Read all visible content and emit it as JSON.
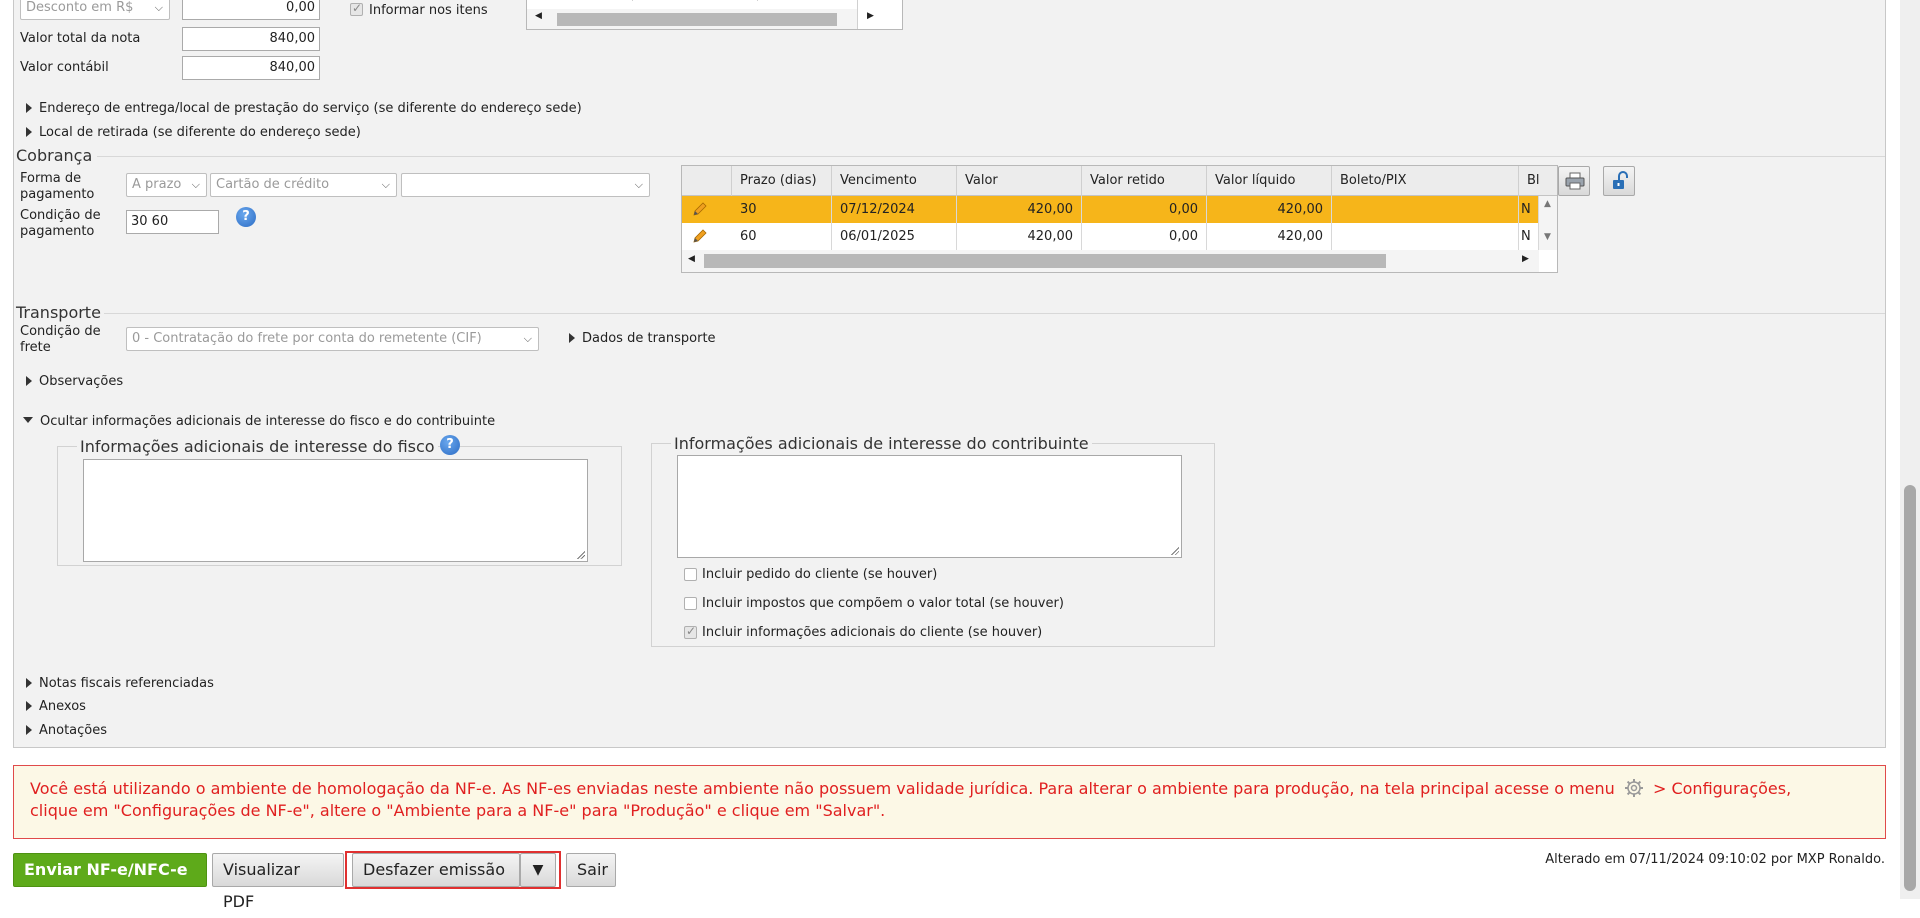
{
  "totals": {
    "discount_select": "Desconto em R$",
    "discount_value": "0,00",
    "informar_itens": "Informar nos itens",
    "total_nota_label": "Valor total da nota",
    "total_nota_value": "840,00",
    "contabil_label": "Valor contábil",
    "contabil_value": "840,00"
  },
  "toggles": {
    "endereco_entrega": "Endereço de entrega/local de prestação do serviço (se diferente do endereço sede)",
    "local_retirada": "Local de retirada (se diferente do endereço sede)",
    "observacoes": "Observações",
    "ocultar_info": "Ocultar informações adicionais de interesse do fisco e do contribuinte",
    "notas_referenciadas": "Notas fiscais referenciadas",
    "anexos": "Anexos",
    "anotacoes": "Anotações"
  },
  "cobranca": {
    "title": "Cobrança",
    "forma_label_1": "Forma de",
    "forma_label_2": "pagamento",
    "forma_select_1": "A prazo",
    "forma_select_2": "Cartão de crédito",
    "forma_select_3": "",
    "condicao_label_1": "Condição de",
    "condicao_label_2": "pagamento",
    "condicao_value": "30 60",
    "help": "?",
    "grid": {
      "headers": [
        "",
        "Prazo (dias)",
        "Vencimento",
        "Valor",
        "Valor retido",
        "Valor líquido",
        "Boleto/PIX",
        "Bl"
      ],
      "rows": [
        [
          "",
          "30",
          "07/12/2024",
          "420,00",
          "0,00",
          "420,00",
          "",
          "N"
        ],
        [
          "",
          "60",
          "06/01/2025",
          "420,00",
          "0,00",
          "420,00",
          "",
          "N"
        ]
      ]
    }
  },
  "transporte": {
    "title": "Transporte",
    "condicao_label_1": "Condição de",
    "condicao_label_2": "frete",
    "frete_select": "0 - Contratação do frete por conta do remetente (CIF)",
    "dados_transporte": "Dados de transporte"
  },
  "info_adicionais": {
    "fisco_legend": "Informações adicionais de interesse do fisco",
    "contribuinte_legend": "Informações adicionais de interesse do contribuinte",
    "help": "?",
    "fisco_text": "",
    "contribuinte_text": "",
    "checkboxes": [
      {
        "label": "Incluir pedido do cliente (se houver)",
        "checked": false
      },
      {
        "label": "Incluir impostos que compõem o valor total (se houver)",
        "checked": false
      },
      {
        "label": "Incluir informações adicionais do cliente (se houver)",
        "checked": true
      }
    ]
  },
  "alert": {
    "line1": "Você está utilizando o ambiente de homologação da NF-e. As NF-es enviadas neste ambiente não possuem validade jurídica. Para alterar o ambiente para produção, na tela principal acesse o menu",
    "line1_end": "> Configurações,",
    "line2": "clique em \"Configurações de NF-e\", altere o \"Ambiente para a NF-e\" para \"Produção\" e clique em \"Salvar\"."
  },
  "footer": {
    "enviar": "Enviar NF-e/NFC-e",
    "visualizar": "Visualizar PDF",
    "desfazer": "Desfazer emissão",
    "sair": "Sair",
    "alterado": "Alterado em 07/11/2024 09:10:02 por MXP Ronaldo."
  },
  "colors": {
    "highlight_row": "#f6b51a",
    "alert_text": "#e02020",
    "send_button": "#5eaa1a"
  }
}
